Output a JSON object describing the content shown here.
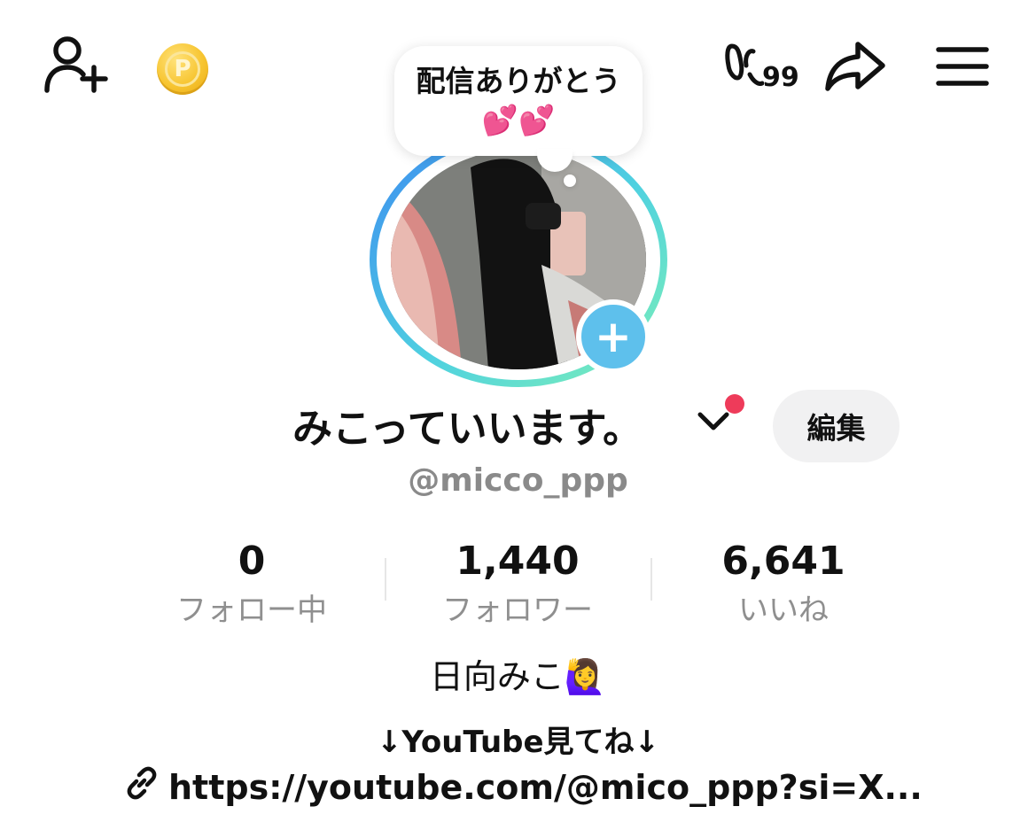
{
  "header": {
    "add_user_icon": "person-plus-icon",
    "coin_label": "P",
    "badge_count": "99",
    "share_icon": "share-arrow-icon",
    "menu_icon": "hamburger-menu-icon"
  },
  "bubble": {
    "text": "配信ありがとう💕💕"
  },
  "profile": {
    "display_name": "みこっていいます。",
    "edit_label": "編集",
    "handle": "@micco_ppp",
    "accent_color": "#5ec0ec",
    "notification_dot_color": "#ee3b5a"
  },
  "stats": [
    {
      "value": "0",
      "label": "フォロー中"
    },
    {
      "value": "1,440",
      "label": "フォロワー"
    },
    {
      "value": "6,641",
      "label": "いいね"
    }
  ],
  "bio": {
    "line1": "日向みこ🙋‍♀️",
    "line2": "↓YouTube見てね↓",
    "link": "https://youtube.com/@mico_ppp?si=X..."
  }
}
